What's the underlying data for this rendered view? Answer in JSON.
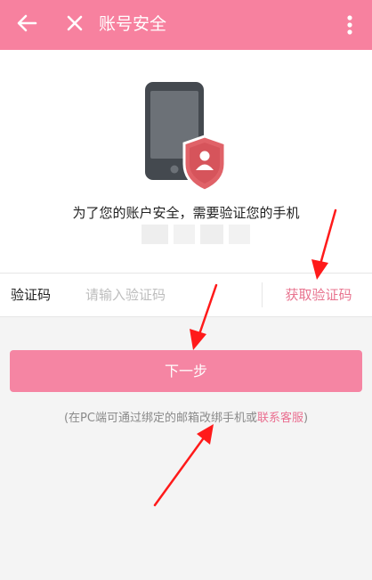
{
  "appbar": {
    "title": "账号安全",
    "back_icon": "arrow-left-icon",
    "close_icon": "close-icon",
    "more_icon": "more-vertical-icon"
  },
  "main": {
    "illustration_icon": "phone-shield-icon",
    "verify_message": "为了您的账户安全，需要验证您的手机"
  },
  "code_row": {
    "label": "验证码",
    "placeholder": "请输入验证码",
    "value": "",
    "get_code_label": "获取验证码"
  },
  "next_button": {
    "label": "下一步"
  },
  "note": {
    "prefix": "(在PC端可通过绑定的邮箱改绑手机或",
    "link": "联系客服",
    "suffix": ")"
  },
  "colors": {
    "appbar": "#f7819f",
    "button": "#f585a3",
    "link": "#e8748f",
    "annotation_arrow": "#ff1a1a"
  }
}
